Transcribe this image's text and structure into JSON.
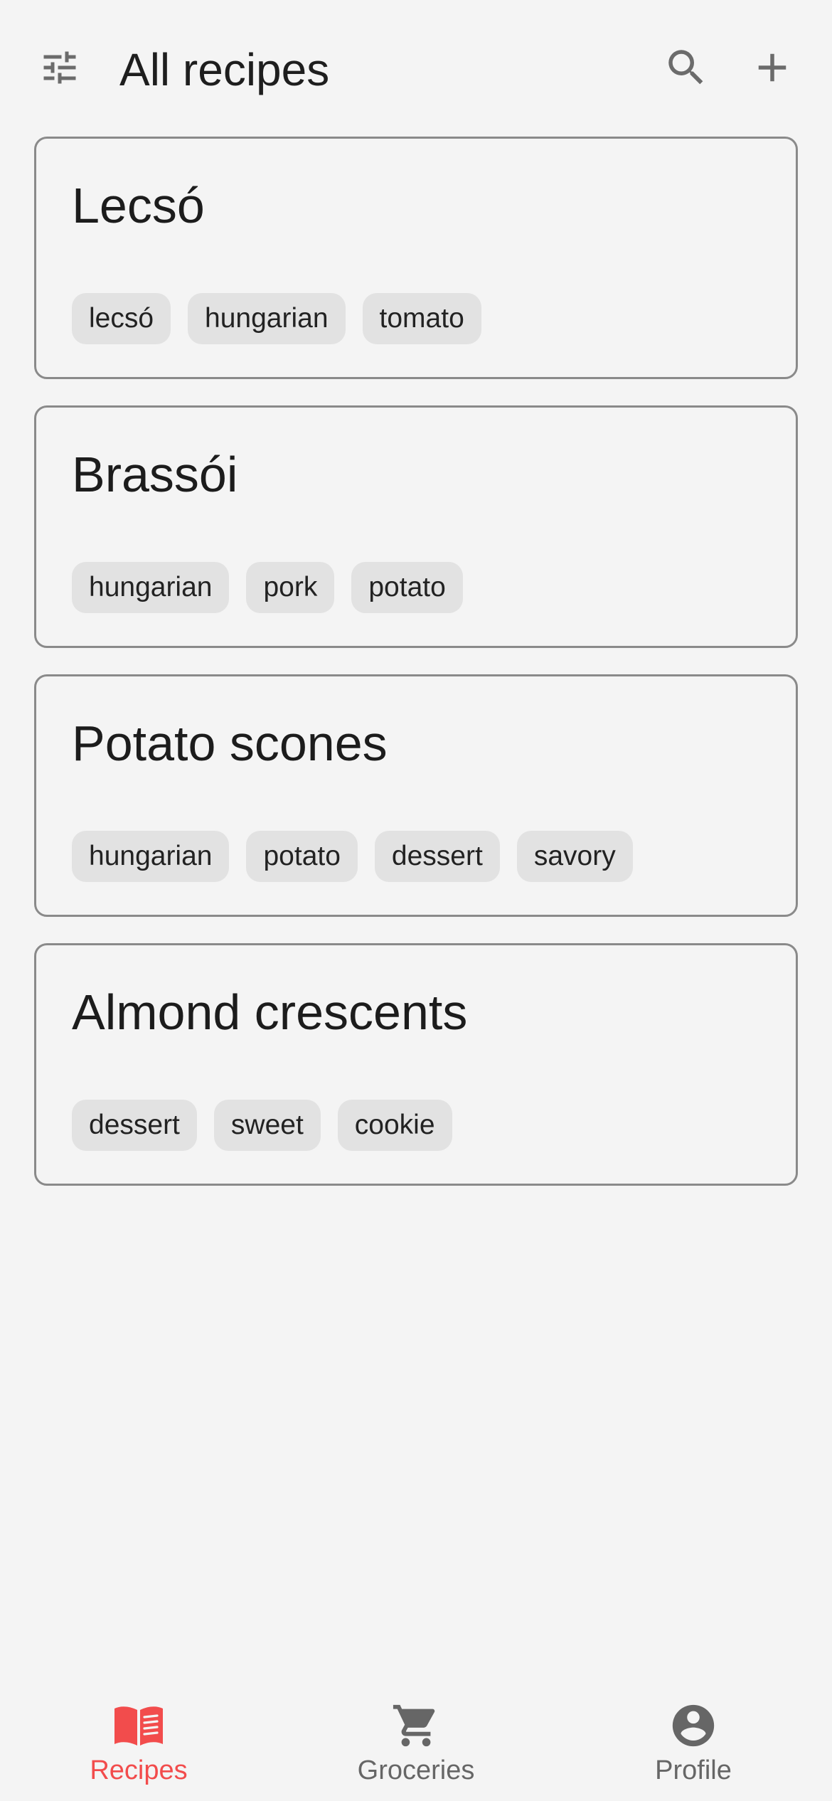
{
  "header": {
    "title": "All recipes",
    "left_icon": "tune-filter-icon",
    "right_icons": [
      "search-icon",
      "add-icon"
    ]
  },
  "recipes": [
    {
      "title": "Lecsó",
      "tags": [
        "lecsó",
        "hungarian",
        "tomato"
      ]
    },
    {
      "title": "Brassói",
      "tags": [
        "hungarian",
        "pork",
        "potato"
      ]
    },
    {
      "title": "Potato scones",
      "tags": [
        "hungarian",
        "potato",
        "dessert",
        "savory"
      ]
    },
    {
      "title": "Almond crescents",
      "tags": [
        "dessert",
        "sweet",
        "cookie"
      ]
    }
  ],
  "bottom_nav": {
    "items": [
      {
        "label": "Recipes",
        "icon": "book-icon",
        "active": true
      },
      {
        "label": "Groceries",
        "icon": "cart-icon",
        "active": false
      },
      {
        "label": "Profile",
        "icon": "account-icon",
        "active": false
      }
    ]
  },
  "colors": {
    "background": "#f4f4f4",
    "accent": "#f24c4c",
    "icon_gray": "#666666",
    "tag_bg": "#e2e2e2",
    "card_border": "#8a8a8a"
  }
}
